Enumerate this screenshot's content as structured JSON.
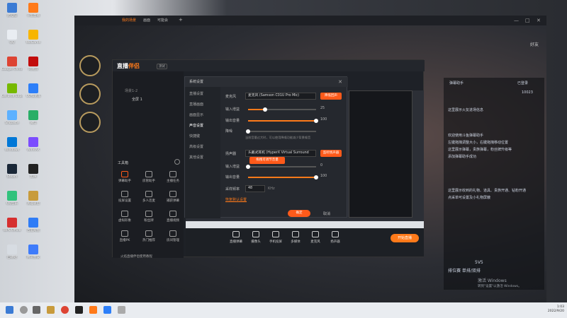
{
  "desktop_icons": [
    {
      "label": "此电脑",
      "color": "#3b7bd4"
    },
    {
      "label": "QQ",
      "color": "#e9edf2"
    },
    {
      "label": "Google Chrome",
      "color": "#dd4433"
    },
    {
      "label": "GeForce Experience",
      "color": "#76b900"
    },
    {
      "label": "Snipaste",
      "color": "#5db1ff"
    },
    {
      "label": "Windows",
      "color": "#0078d7"
    },
    {
      "label": "Steam",
      "color": "#1b2838"
    },
    {
      "label": "QQ音乐",
      "color": "#31c27c"
    },
    {
      "label": "WPS Office",
      "color": "#d62f2f"
    },
    {
      "label": "回收站",
      "color": "#d7dce2"
    },
    {
      "label": "斗鱼直播",
      "color": "#ff7a1a"
    },
    {
      "label": "WeGame",
      "color": "#f7b500"
    },
    {
      "label": "网易云",
      "color": "#c20c0c"
    },
    {
      "label": "UU加速器",
      "color": "#2d7ff9"
    },
    {
      "label": "微信",
      "color": "#2aae67"
    },
    {
      "label": "WinRAR",
      "color": "#7c4dff"
    },
    {
      "label": "剪映",
      "color": "#222222"
    },
    {
      "label": "英雄联盟",
      "color": "#c89b3c"
    },
    {
      "label": "百度网盘",
      "color": "#2f7cf6"
    },
    {
      "label": "腾讯会议",
      "color": "#3e7bfa"
    }
  ],
  "game_window": {
    "min": "—",
    "max": "□",
    "close": "✕"
  },
  "lol_right_panel": {
    "header": "好友",
    "list_title": "弹幕助手",
    "status": "已登录",
    "num": "10023",
    "lines": [
      "这里展示火友进场信息",
      "欢迎使用斗鱼弹幕助手",
      "左键拖拽调整大小，右键拖拽移动位置",
      "这里展示弹幕，贵族弹幕，粉丝牌升级等",
      "添加弹幕助手成功",
      "这里展示收到的礼物、道具、贵族开通、钻粉开通",
      "点采单可设置及小礼物屏蔽"
    ],
    "mode": "5V5",
    "queue": "排位赛 单排/双排",
    "activate1": "激活 Windows",
    "activate2": "转到\"设置\"以激活 Windows。"
  },
  "app": {
    "logo_a": "直播",
    "logo_b": "伴侣",
    "version": "测试",
    "tabs": [
      "我的场景",
      "画面",
      "可能会"
    ],
    "add": "+",
    "scenes": [
      "场景1-2",
      "全屏 1"
    ],
    "toolbox_title": "工具箱",
    "tools": [
      "弹幕助手",
      "房管助手",
      "主播任务",
      "投屏设置",
      "多人连麦",
      "捕获弹幕",
      "虚拟形象",
      "粉丝牌",
      "直播视频",
      "直播PK",
      "热门推荐",
      "房间管理"
    ],
    "note": "火焰直播伴侣使用教程",
    "bottom_buttons": [
      "直播弹幕",
      "摄像头",
      "手机投屏",
      "多媒体",
      "麦克风",
      "扬声器"
    ],
    "start_live": "开始直播"
  },
  "dialog": {
    "title": "系统设置",
    "close": "✕",
    "nav": [
      "直播设置",
      "直播画面",
      "画面显示",
      "声音设置",
      "快捷键",
      "高级设置",
      "其他设置"
    ],
    "nav_active": "声音设置",
    "mic_label": "麦克风",
    "mic_value": "麦克风 (Samson C01U Pro Mic)",
    "mic_btn": "降低回声",
    "in_vol_label": "输入增益",
    "in_vol_value": "25",
    "in_vol_fraction": 0.25,
    "out_vol_label": "输出音量",
    "out_vol_value": "100",
    "out_vol_fraction": 1.0,
    "noise_label": "降噪",
    "noise_desc": "当前音量过大时，可以使用降噪功能减少背景噪音",
    "noise_fraction": 0.0,
    "spk_label": "扬声器",
    "spk_value": "头戴式耳机 (HyperX Virtual Surround",
    "spk_btn": "监听扬声器",
    "tooltip": "拖拽可调节音量",
    "spk_in_label": "输入增益",
    "spk_in_value": "0",
    "spk_in_fraction": 0.0,
    "spk_out_label": "输出音量",
    "spk_out_value": "100",
    "spk_out_fraction": 1.0,
    "sample_label": "采样频率",
    "sample_value": "48",
    "sample_unit": "KHz",
    "reset_link": "恢复默认设置",
    "ok": "确定",
    "cancel": "取消"
  },
  "taskbar": {
    "time": "1:03",
    "date": "2022/9/20"
  }
}
